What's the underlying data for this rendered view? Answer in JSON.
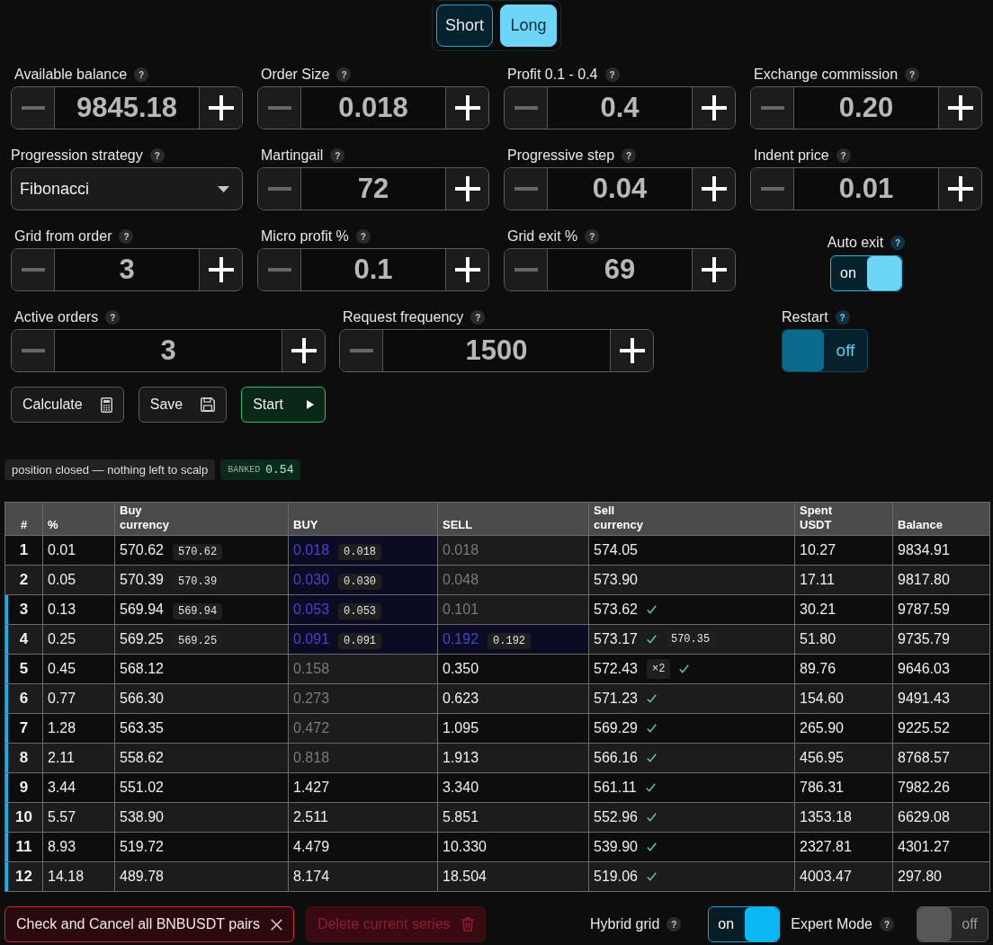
{
  "direction_tabs": [
    {
      "label": "Short",
      "selected": false
    },
    {
      "label": "Long",
      "selected": true
    }
  ],
  "settings": [
    [
      {
        "kind": "stepper",
        "label": "Available balance",
        "help": "?",
        "value": "9845.18"
      },
      {
        "kind": "stepper",
        "label": "Order Size",
        "help": "?",
        "value": "0.018"
      },
      {
        "kind": "stepper",
        "label": "Profit 0.1 - 0.4",
        "help": "?",
        "value": "0.4"
      },
      {
        "kind": "stepper",
        "label": "Exchange commission",
        "help": "?",
        "value": "0.20"
      }
    ],
    [
      {
        "kind": "select",
        "label": "Progression strategy",
        "help": "?",
        "value": "Fibonacci"
      },
      {
        "kind": "stepper",
        "label": "Martingail",
        "help": "?",
        "value": "72"
      },
      {
        "kind": "stepper",
        "label": "Progressive step",
        "help": "?",
        "value": "0.04"
      },
      {
        "kind": "stepper",
        "label": "Indent price",
        "help": "?",
        "value": "0.01"
      }
    ],
    [
      {
        "kind": "stepper",
        "label": "Grid from order",
        "help": "?",
        "value": "3"
      },
      {
        "kind": "stepper",
        "label": "Micro profit %",
        "help": "?",
        "value": "0.1"
      },
      {
        "kind": "stepper",
        "label": "Grid exit %",
        "help": "?",
        "value": "69"
      },
      {
        "kind": "toggle",
        "label": "Auto exit",
        "help": "?",
        "on": true,
        "state_text": "on"
      }
    ],
    [
      {
        "kind": "stepper",
        "label": "Active orders",
        "help": "?",
        "value": "3"
      },
      {
        "kind": "stepper",
        "label": "Request frequency",
        "help": "?",
        "value": "1500"
      },
      {
        "kind": "toggle",
        "label": "Restart",
        "help": "?",
        "on": false,
        "state_text": "off"
      }
    ]
  ],
  "actions": [
    {
      "kind": "calculate",
      "label": "Calculate"
    },
    {
      "kind": "save",
      "label": "Save"
    },
    {
      "kind": "start",
      "label": "Start"
    }
  ],
  "status": {
    "message": "position closed — nothing left to scalp",
    "banked_label": "BANKED",
    "banked_value": "0.54"
  },
  "table": {
    "columns": [
      "#",
      "%",
      "Buy currency",
      "BUY",
      "SELL",
      "Sell currency",
      "Spent USDT",
      "Balance"
    ],
    "rows": [
      {
        "highlighted": false,
        "number": "1",
        "percent": "0.01",
        "buy_currency": {
          "value": "570.62",
          "badge": "570.62"
        },
        "buy": {
          "value": "0.018",
          "placed": true,
          "dimmed": false,
          "badge": "0.018"
        },
        "sell": {
          "value": "0.018",
          "placed": false,
          "dimmed": true
        },
        "sell_currency": {
          "value": "574.05",
          "checked": false
        },
        "spent_usdt": "10.27",
        "balance": "9834.91"
      },
      {
        "highlighted": false,
        "number": "2",
        "percent": "0.05",
        "buy_currency": {
          "value": "570.39",
          "badge": "570.39"
        },
        "buy": {
          "value": "0.030",
          "placed": true,
          "dimmed": false,
          "badge": "0.030"
        },
        "sell": {
          "value": "0.048",
          "placed": false,
          "dimmed": true
        },
        "sell_currency": {
          "value": "573.90",
          "checked": false
        },
        "spent_usdt": "17.11",
        "balance": "9817.80"
      },
      {
        "highlighted": true,
        "number": "3",
        "percent": "0.13",
        "buy_currency": {
          "value": "569.94",
          "badge": "569.94"
        },
        "buy": {
          "value": "0.053",
          "placed": true,
          "dimmed": false,
          "badge": "0.053"
        },
        "sell": {
          "value": "0.101",
          "placed": false,
          "dimmed": true
        },
        "sell_currency": {
          "value": "573.62",
          "checked": true
        },
        "spent_usdt": "30.21",
        "balance": "9787.59"
      },
      {
        "highlighted": true,
        "number": "4",
        "percent": "0.25",
        "buy_currency": {
          "value": "569.25",
          "badge": "569.25"
        },
        "buy": {
          "value": "0.091",
          "placed": true,
          "dimmed": false,
          "badge": "0.091"
        },
        "sell": {
          "value": "0.192",
          "placed": true,
          "dimmed": false,
          "badge": "0.192"
        },
        "sell_currency": {
          "value": "573.17",
          "checked": true,
          "price_badge": "570.35"
        },
        "spent_usdt": "51.80",
        "balance": "9735.79"
      },
      {
        "highlighted": true,
        "number": "5",
        "percent": "0.45",
        "buy_currency": {
          "value": "568.12"
        },
        "buy": {
          "value": "0.158",
          "placed": false,
          "dimmed": true
        },
        "sell": {
          "value": "0.350",
          "placed": false,
          "dimmed": false
        },
        "sell_currency": {
          "value": "572.43",
          "count_badge": "×2",
          "checked": true
        },
        "spent_usdt": "89.76",
        "balance": "9646.03"
      },
      {
        "highlighted": true,
        "number": "6",
        "percent": "0.77",
        "buy_currency": {
          "value": "566.30"
        },
        "buy": {
          "value": "0.273",
          "placed": false,
          "dimmed": true
        },
        "sell": {
          "value": "0.623",
          "placed": false,
          "dimmed": false
        },
        "sell_currency": {
          "value": "571.23",
          "checked": true
        },
        "spent_usdt": "154.60",
        "balance": "9491.43"
      },
      {
        "highlighted": true,
        "number": "7",
        "percent": "1.28",
        "buy_currency": {
          "value": "563.35"
        },
        "buy": {
          "value": "0.472",
          "placed": false,
          "dimmed": true
        },
        "sell": {
          "value": "1.095",
          "placed": false,
          "dimmed": false
        },
        "sell_currency": {
          "value": "569.29",
          "checked": true
        },
        "spent_usdt": "265.90",
        "balance": "9225.52"
      },
      {
        "highlighted": true,
        "number": "8",
        "percent": "2.11",
        "buy_currency": {
          "value": "558.62"
        },
        "buy": {
          "value": "0.818",
          "placed": false,
          "dimmed": true
        },
        "sell": {
          "value": "1.913",
          "placed": false,
          "dimmed": false
        },
        "sell_currency": {
          "value": "566.16",
          "checked": true
        },
        "spent_usdt": "456.95",
        "balance": "8768.57"
      },
      {
        "highlighted": true,
        "number": "9",
        "percent": "3.44",
        "buy_currency": {
          "value": "551.02"
        },
        "buy": {
          "value": "1.427",
          "placed": false,
          "dimmed": false
        },
        "sell": {
          "value": "3.340",
          "placed": false,
          "dimmed": false
        },
        "sell_currency": {
          "value": "561.11",
          "checked": true
        },
        "spent_usdt": "786.31",
        "balance": "7982.26"
      },
      {
        "highlighted": true,
        "number": "10",
        "percent": "5.57",
        "buy_currency": {
          "value": "538.90"
        },
        "buy": {
          "value": "2.511",
          "placed": false,
          "dimmed": false
        },
        "sell": {
          "value": "5.851",
          "placed": false,
          "dimmed": false
        },
        "sell_currency": {
          "value": "552.96",
          "checked": true
        },
        "spent_usdt": "1353.18",
        "balance": "6629.08"
      },
      {
        "highlighted": true,
        "number": "11",
        "percent": "8.93",
        "buy_currency": {
          "value": "519.72"
        },
        "buy": {
          "value": "4.479",
          "placed": false,
          "dimmed": false
        },
        "sell": {
          "value": "10.330",
          "placed": false,
          "dimmed": false
        },
        "sell_currency": {
          "value": "539.90",
          "checked": true
        },
        "spent_usdt": "2327.81",
        "balance": "4301.27"
      },
      {
        "highlighted": true,
        "number": "12",
        "percent": "14.18",
        "buy_currency": {
          "value": "489.78"
        },
        "buy": {
          "value": "8.174",
          "placed": false,
          "dimmed": false
        },
        "sell": {
          "value": "18.504",
          "placed": false,
          "dimmed": false
        },
        "sell_currency": {
          "value": "519.06",
          "checked": true
        },
        "spent_usdt": "4003.47",
        "balance": "297.80"
      }
    ]
  },
  "footer": {
    "buttons": [
      {
        "kind": "cancel",
        "label": "Check and Cancel all BNBUSDT pairs",
        "disabled": false
      },
      {
        "kind": "delete",
        "label": "Delete current series",
        "disabled": true
      }
    ],
    "toggles": [
      {
        "label": "Hybrid grid",
        "help": "?",
        "on": true,
        "state_text": "on"
      },
      {
        "label": "Expert Mode",
        "help": "?",
        "on": false,
        "state_text": "off"
      }
    ]
  }
}
